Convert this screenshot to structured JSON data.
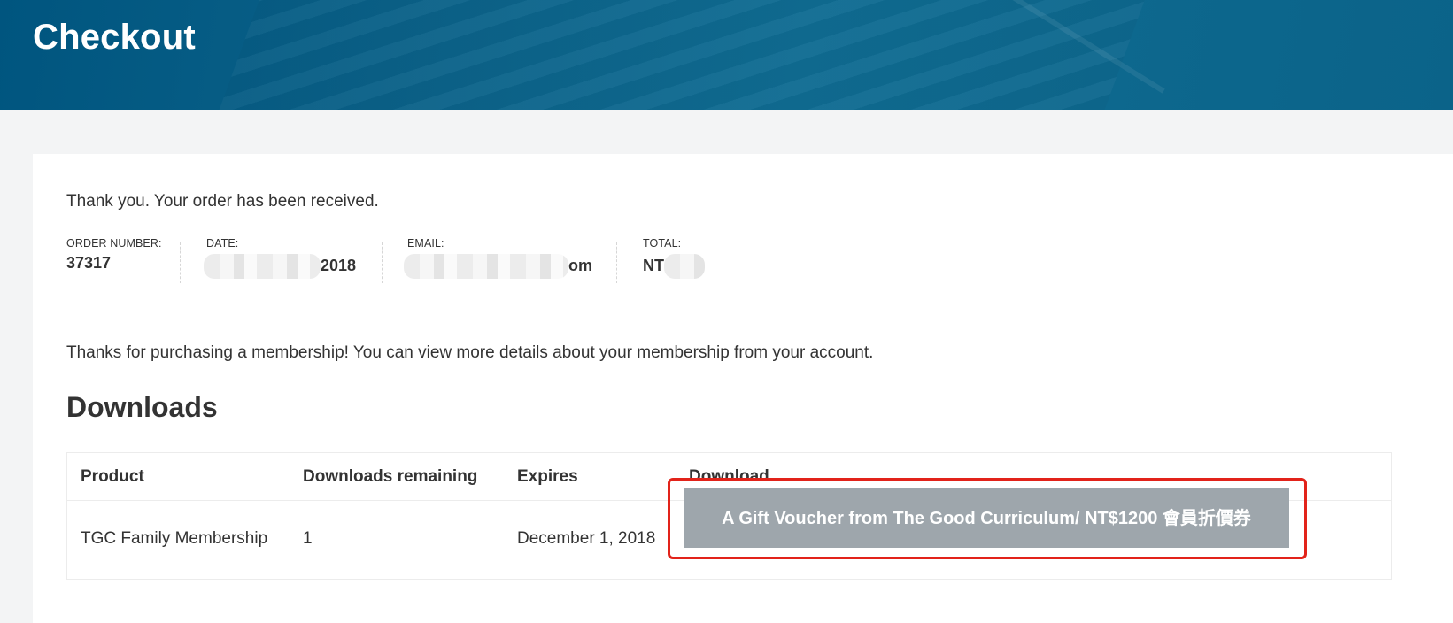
{
  "header": {
    "title": "Checkout"
  },
  "order": {
    "received_text": "Thank you. Your order has been received.",
    "number_label": "ORDER NUMBER:",
    "number_value": "37317",
    "date_label": "DATE:",
    "date_value_visible": "2018",
    "email_label": "EMAIL:",
    "email_value_visible": "om",
    "total_label": "TOTAL:",
    "total_value_visible": "NT"
  },
  "membership": {
    "note_prefix": "Thanks for purchasing a membership! You can view more details about your membership from ",
    "note_link": "your account",
    "note_suffix": "."
  },
  "downloads": {
    "title": "Downloads",
    "columns": [
      "Product",
      "Downloads remaining",
      "Expires",
      "Download"
    ],
    "rows": [
      {
        "product": "TGC Family Membership",
        "remaining": "1",
        "expires": "December 1, 2018",
        "download_label": "A Gift Voucher from The Good Curriculum/ NT$1200 會員折價券"
      }
    ]
  },
  "colors": {
    "header_bg": "#0b6389",
    "page_bg": "#f3f4f5",
    "button_bg": "#9ea6ac",
    "highlight_border": "#e2231a"
  }
}
